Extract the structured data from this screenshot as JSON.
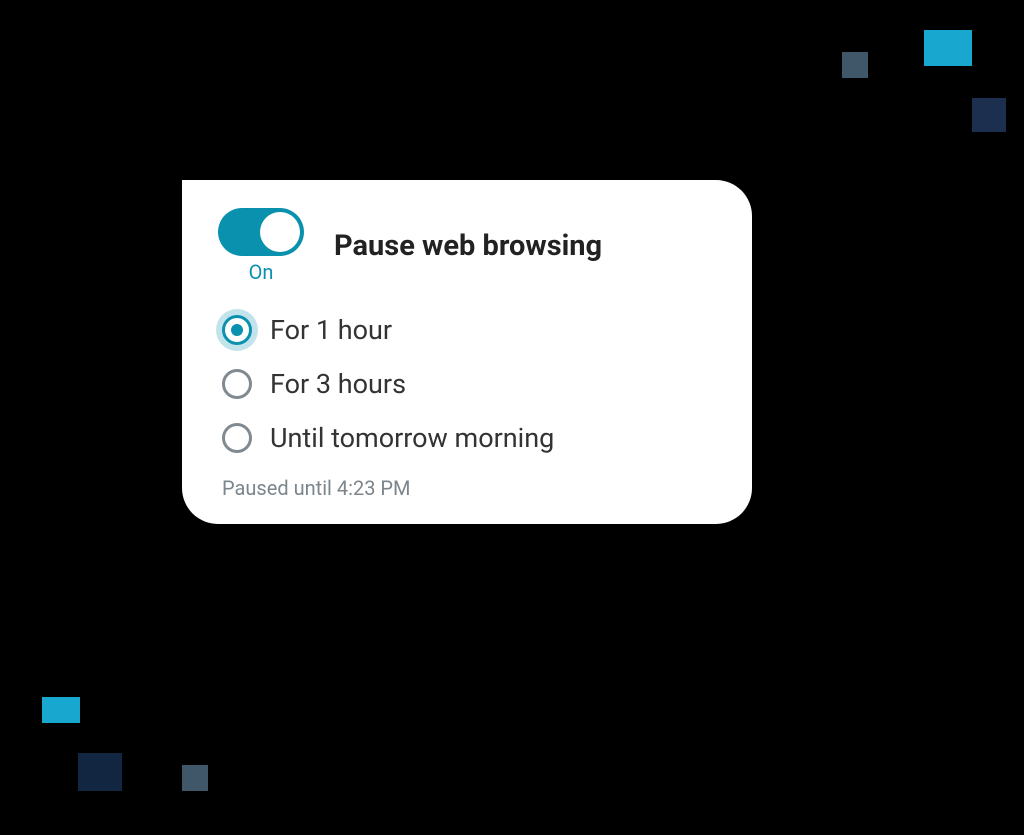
{
  "toggle": {
    "on": true,
    "state_label": "On"
  },
  "title": "Pause web browsing",
  "options": [
    {
      "label": "For 1 hour",
      "selected": true
    },
    {
      "label": "For 3 hours",
      "selected": false
    },
    {
      "label": "Until tomorrow morning",
      "selected": false
    }
  ],
  "status": "Paused until 4:23 PM",
  "colors": {
    "accent": "#0a91ae",
    "deco_cyan": "#18a7cf",
    "deco_gray": "#40576a",
    "deco_navy": "#1d2f4e"
  }
}
